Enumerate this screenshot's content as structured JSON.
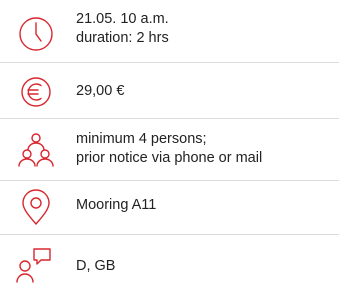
{
  "accent_color": "#d9262e",
  "details": [
    {
      "icon": "clock-icon",
      "lines": [
        "21.05. 10 a.m.",
        "duration: 2 hrs"
      ]
    },
    {
      "icon": "euro-icon",
      "lines": [
        "29,00 €"
      ]
    },
    {
      "icon": "group-icon",
      "lines": [
        "minimum 4 persons;",
        "prior notice via phone or mail"
      ]
    },
    {
      "icon": "location-pin-icon",
      "lines": [
        "Mooring A11"
      ]
    },
    {
      "icon": "speech-bubble-person-icon",
      "lines": [
        "D, GB"
      ]
    }
  ]
}
